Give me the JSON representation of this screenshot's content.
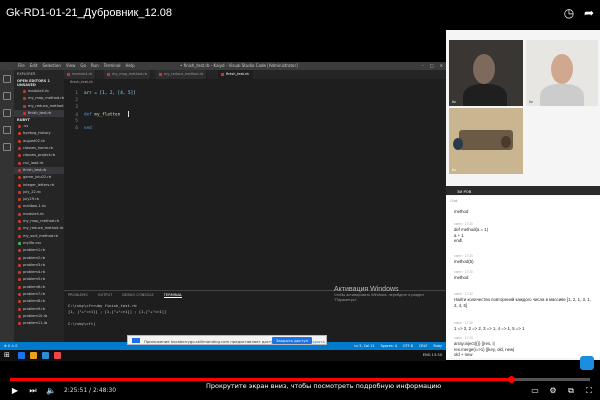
{
  "video": {
    "title": "Gk-RD1-01-21_Дубровник_12.08",
    "current_time": "2:25:51",
    "total_time": "2:48:30",
    "progress": 0.864,
    "scroll_hint": "Прокрутите экран вниз, чтобы посмотреть подробную информацию"
  },
  "vscode": {
    "menu": [
      "File",
      "Edit",
      "Selection",
      "View",
      "Go",
      "Run",
      "Terminal",
      "Help"
    ],
    "window_title": "• finish_test.rb - Kaiyd - Visual Studio Code [Administrator]",
    "explorer_label": "EXPLORER",
    "open_editors_label": "OPEN EDITORS 1 UNSAVED",
    "open_editors": [
      "module4.rb",
      "my_map_method.rb",
      "my_reduce_method.rb",
      "finish_test.rb"
    ],
    "folder_label": "RUBYT",
    "files": [
      ".vs",
      "byebug_history",
      "august02.rb",
      "classes_home.rb",
      "classes_project.rb",
      "csv_load.rb",
      "finish_test.rb",
      "game_julu02.rb",
      "integer_letters.rb",
      "july_22.rb",
      "july29.rb",
      "mailbox-1.rb",
      "module4.rb",
      "my_map_method.rb",
      "my_reduce_method.rb",
      "my_sort_method.rb",
      "mylife.csv",
      "problem1.rb",
      "problem2.rb",
      "problem3.rb",
      "problem4.rb",
      "problem5.rb",
      "problem6.rb",
      "problem7.rb",
      "problem8.rb",
      "problem9.rb",
      "problem10.rb",
      "problem11.rb"
    ],
    "tabs": [
      "module4.rb",
      "my_map_method.rb",
      "my_reduce_method.rb",
      "finish_test.rb"
    ],
    "breadcrumb": "finish_test.rb",
    "code_lines": [
      {
        "n": "1",
        "text": "arr = [1, 2, [4, 5]]"
      },
      {
        "n": "2",
        "text": ""
      },
      {
        "n": "3",
        "text": ""
      },
      {
        "n": "4",
        "text": "def my_flatten"
      },
      {
        "n": "5",
        "text": ""
      },
      {
        "n": "6",
        "text": "end"
      }
    ],
    "panel_tabs": [
      "PROBLEMS",
      "OUTPUT",
      "DEBUG CONSOLE",
      "TERMINAL"
    ],
    "terminal_lines": [
      "C:\\ruby\\cf>ruby finish_test.rb",
      "[1, [\"+\"=>1]] ; [1,[\"+\"=>1]] ; [1,[\"+\"=>1]]",
      "",
      "C:\\ruby\\cf>|"
    ],
    "status_left": "⊗ 0 ⚠ 0",
    "status_right": [
      "Ln 5, Col 11",
      "Spaces: 4",
      "UTF-8",
      "CRLF",
      "Ruby"
    ],
    "activation_title": "Активация Windows",
    "activation_sub": "Чтобы активировать Windows, перейдите в раздел \"Параметры\"."
  },
  "share_bar": {
    "text": "Приложение hocaberrygo.skilimonding.com предоставляет доступ к вашему экрану.",
    "stop_label": "Закрыть доступ",
    "hide_label": "Скрыть"
  },
  "taskbar": {
    "time": "ENG  13:30"
  },
  "participants": [
    {
      "label": "Ilz"
    },
    {
      "label": "Ilz"
    },
    {
      "label": "Ilz"
    }
  ],
  "chat": {
    "header": "ЗИ РОВ",
    "top_label": "Chat",
    "messages": [
      {
        "meta": "",
        "text": "method"
      },
      {
        "meta": "name · 17:30",
        "text": "def method(a = 1)\n  a + 1\nend\\"
      },
      {
        "meta": "name · 17:30",
        "text": "method(5)"
      },
      {
        "meta": "name · 17:30",
        "text": "method"
      },
      {
        "meta": "name · 17:32",
        "text": "Найти количество повторений каждого числа в массиве [1, 2, 1, 3, 1, 2, 4, 5]"
      },
      {
        "meta": "name · 17:32",
        "text": "1 => 3, 2 => 2, 3 => 1, 4 => 1, 5 => 1"
      },
      {
        "meta": "name · 17:33",
        "text": "array.inject({}) {|res, i|\n  res.merge(i=>1) {|key, old, new|\n    old + new\n}"
      }
    ]
  }
}
